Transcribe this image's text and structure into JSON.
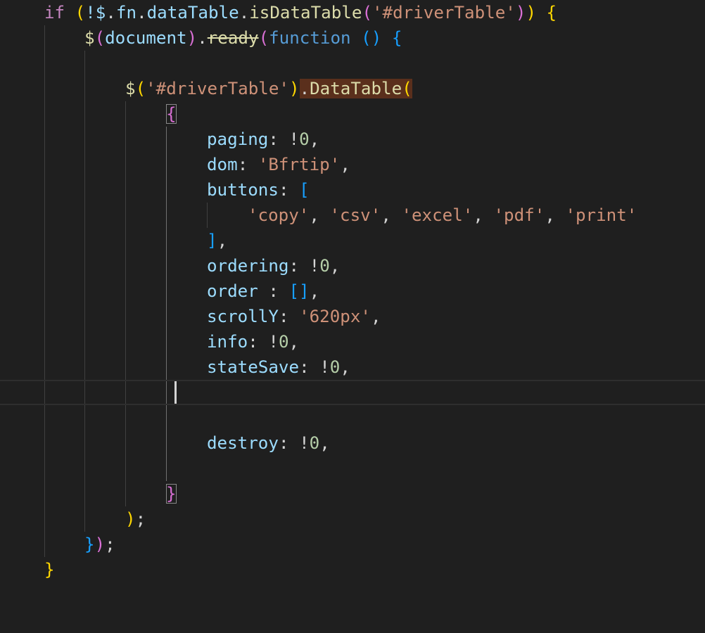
{
  "editor": {
    "lines": {
      "l1": {
        "kw_if": "if",
        "paren_open": " (",
        "not_dollar": "!$",
        "dot1": ".",
        "fn": "fn",
        "dot2": ".",
        "dataTable": "dataTable",
        "dot3": ".",
        "isDataTable": "isDataTable",
        "call_open": "(",
        "selector": "'#driverTable'",
        "call_close": ")",
        "paren_close": ")",
        "brace_open": " {"
      },
      "l2": {
        "dollar": "$",
        "paren_open": "(",
        "document": "document",
        "paren_close": ")",
        "dot": ".",
        "ready": "ready",
        "call_open": "(",
        "function_kw": "function",
        "params": " ()",
        "brace_open": " {"
      },
      "l4": {
        "dollar": "$",
        "paren_open": "(",
        "selector": "'#driverTable'",
        "paren_close": ")",
        "call": ".DataTable",
        "call_open": "("
      },
      "l5": {
        "brace_open": "{"
      },
      "l6": {
        "key": "paging",
        "colon": ": ",
        "bang": "!",
        "value": "0",
        "comma": ","
      },
      "l7": {
        "key": "dom",
        "colon": ": ",
        "value": "'Bfrtip'",
        "comma": ","
      },
      "l8": {
        "key": "buttons",
        "colon": ": ",
        "bracket_open": "["
      },
      "l9": {
        "s1": "'copy'",
        "c1": ", ",
        "s2": "'csv'",
        "c2": ", ",
        "s3": "'excel'",
        "c3": ", ",
        "s4": "'pdf'",
        "c4": ", ",
        "s5": "'print'"
      },
      "l10": {
        "bracket_close": "]",
        "comma": ","
      },
      "l11": {
        "key": "ordering",
        "colon": ": ",
        "bang": "!",
        "value": "0",
        "comma": ","
      },
      "l12": {
        "key": "order",
        "colon": " : ",
        "value": "[]",
        "comma": ","
      },
      "l13": {
        "key": "scrollY",
        "colon": ": ",
        "value": "'620px'",
        "comma": ","
      },
      "l14": {
        "key": "info",
        "colon": ": ",
        "bang": "!",
        "value": "0",
        "comma": ","
      },
      "l15": {
        "key": "stateSave",
        "colon": ": ",
        "bang": "!",
        "value": "0",
        "comma": ","
      },
      "l18": {
        "key": "destroy",
        "colon": ": ",
        "bang": "!",
        "value": "0",
        "comma": ","
      },
      "l20": {
        "brace_close": "}"
      },
      "l21": {
        "paren_close": ")",
        "semi": ";"
      },
      "l22": {
        "brace_close": "}",
        "paren_close": ")",
        "semi": ";"
      },
      "l23": {
        "brace_close": "}"
      }
    },
    "colors": {
      "background": "#1f1f1f",
      "keyword_control": "#c586c0",
      "keyword": "#569cd6",
      "variable": "#9cdcfe",
      "function": "#dcdcaa",
      "string": "#ce9178",
      "number": "#b5cea8",
      "bracket_level1": "#ffd700",
      "bracket_level2": "#da70d6",
      "bracket_level3": "#179fff",
      "call_highlight": "#5a2f1c"
    }
  }
}
